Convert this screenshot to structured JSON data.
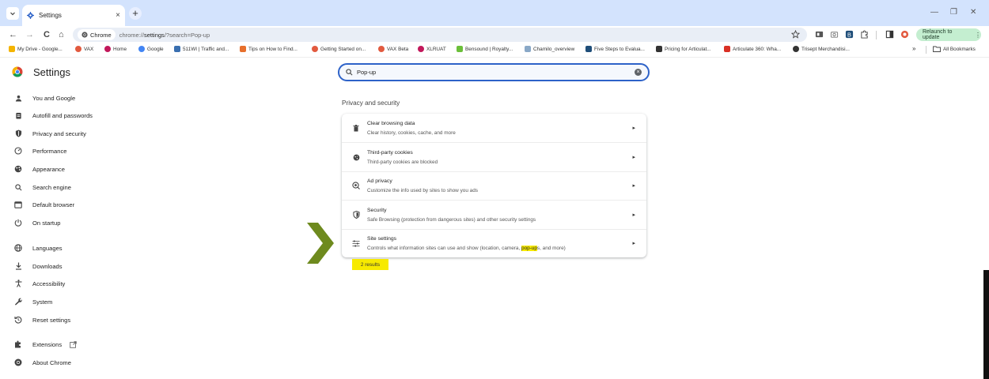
{
  "window": {
    "tab_title": "Settings",
    "tab_close": "×",
    "new_tab": "+",
    "minimize": "—",
    "maximize": "❐",
    "close": "✕"
  },
  "toolbar": {
    "back": "←",
    "forward": "→",
    "reload": "C",
    "home": "⌂",
    "site_chip": "Chrome",
    "url_prefix": "chrome://",
    "url_bold": "settings",
    "url_suffix": "/?search=Pop-up",
    "relaunch": "Relaunch to update"
  },
  "bookmarks": {
    "items": [
      {
        "label": "My Drive - Google...",
        "color": "#f4b400"
      },
      {
        "label": "VAX",
        "color": "#e25a3f"
      },
      {
        "label": "Home",
        "color": "#c2185b"
      },
      {
        "label": "Google",
        "color": "#4285f4"
      },
      {
        "label": "511WI | Traffic and...",
        "color": "#3a6fb0"
      },
      {
        "label": "Tips on How to Find...",
        "color": "#e76f2c"
      },
      {
        "label": "Getting Started on...",
        "color": "#e25a3f"
      },
      {
        "label": "VAX Beta",
        "color": "#e25a3f"
      },
      {
        "label": "XLRUAT",
        "color": "#c2185b"
      },
      {
        "label": "Bensound | Royalty...",
        "color": "#6bbf3a"
      },
      {
        "label": "Chamilo_overview",
        "color": "#8aa8c7"
      },
      {
        "label": "Five Steps to Evalua...",
        "color": "#1f4e79"
      },
      {
        "label": "Pricing for Articulat...",
        "color": "#333333"
      },
      {
        "label": "Articulate 360: Wha...",
        "color": "#d93025"
      },
      {
        "label": "Trisept Merchandisi...",
        "color": "#333333"
      }
    ],
    "more": "»",
    "all_bookmarks": "All Bookmarks"
  },
  "header": {
    "title": "Settings",
    "search_value": "Pop-up",
    "search_clear": "×"
  },
  "sidebar": {
    "items": [
      {
        "label": "You and Google",
        "icon": "person-icon"
      },
      {
        "label": "Autofill and passwords",
        "icon": "clipboard-icon"
      },
      {
        "label": "Privacy and security",
        "icon": "shield-icon"
      },
      {
        "label": "Performance",
        "icon": "speedometer-icon"
      },
      {
        "label": "Appearance",
        "icon": "palette-icon"
      },
      {
        "label": "Search engine",
        "icon": "search-icon"
      },
      {
        "label": "Default browser",
        "icon": "browser-icon"
      },
      {
        "label": "On startup",
        "icon": "power-icon"
      },
      {
        "label": "Languages",
        "icon": "globe-icon"
      },
      {
        "label": "Downloads",
        "icon": "download-icon"
      },
      {
        "label": "Accessibility",
        "icon": "accessibility-icon"
      },
      {
        "label": "System",
        "icon": "wrench-icon"
      },
      {
        "label": "Reset settings",
        "icon": "reset-icon"
      },
      {
        "label": "Extensions",
        "icon": "puzzle-icon"
      },
      {
        "label": "About Chrome",
        "icon": "chrome-icon"
      }
    ]
  },
  "main": {
    "section_title": "Privacy and security",
    "rows": [
      {
        "title": "Clear browsing data",
        "subtitle": "Clear history, cookies, cache, and more",
        "icon": "trash-icon"
      },
      {
        "title": "Third-party cookies",
        "subtitle": "Third-party cookies are blocked",
        "icon": "cookie-icon"
      },
      {
        "title": "Ad privacy",
        "subtitle": "Customize the info used by sites to show you ads",
        "icon": "ad-privacy-icon"
      },
      {
        "title": "Security",
        "subtitle": "Safe Browsing (protection from dangerous sites) and other security settings",
        "icon": "security-shield-icon"
      },
      {
        "title": "Site settings",
        "subtitle_before": "Controls what information sites can use and show (location, camera, ",
        "subtitle_highlight": "pop-up",
        "subtitle_after": "s, and more)",
        "icon": "sliders-icon"
      }
    ],
    "chevron": "▸",
    "results": "2 results"
  },
  "colors": {
    "titlebar": "#d3e3fd",
    "search_border": "#2d62c8",
    "highlight": "#f7ea00",
    "arrow": "#6e8a1e",
    "relaunch_bg": "#c4eed0"
  }
}
